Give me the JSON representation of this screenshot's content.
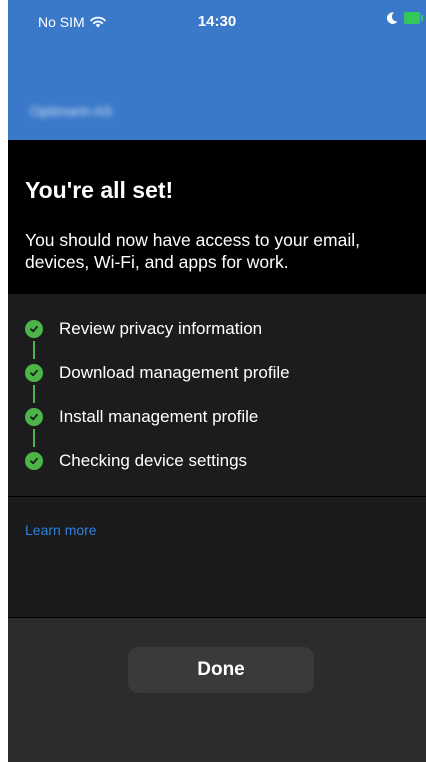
{
  "status_bar": {
    "carrier": "No SIM",
    "time": "14:30",
    "wifi_icon": "wifi-icon",
    "moon_icon": "moon-icon",
    "battery_icon": "battery-charging-icon"
  },
  "header": {
    "title": "Optimarin AS"
  },
  "main": {
    "heading": "You're all set!",
    "subtext": "You should now have access to your email, devices, Wi-Fi, and apps for work."
  },
  "steps": [
    {
      "label": "Review privacy information",
      "status": "complete"
    },
    {
      "label": "Download management profile",
      "status": "complete"
    },
    {
      "label": "Install management profile",
      "status": "complete"
    },
    {
      "label": "Checking device settings",
      "status": "complete"
    }
  ],
  "links": {
    "learn_more": "Learn more"
  },
  "footer": {
    "done_label": "Done"
  },
  "colors": {
    "header_blue": "#3a78c9",
    "check_green": "#4cb548",
    "link_blue": "#2f7ee0"
  }
}
